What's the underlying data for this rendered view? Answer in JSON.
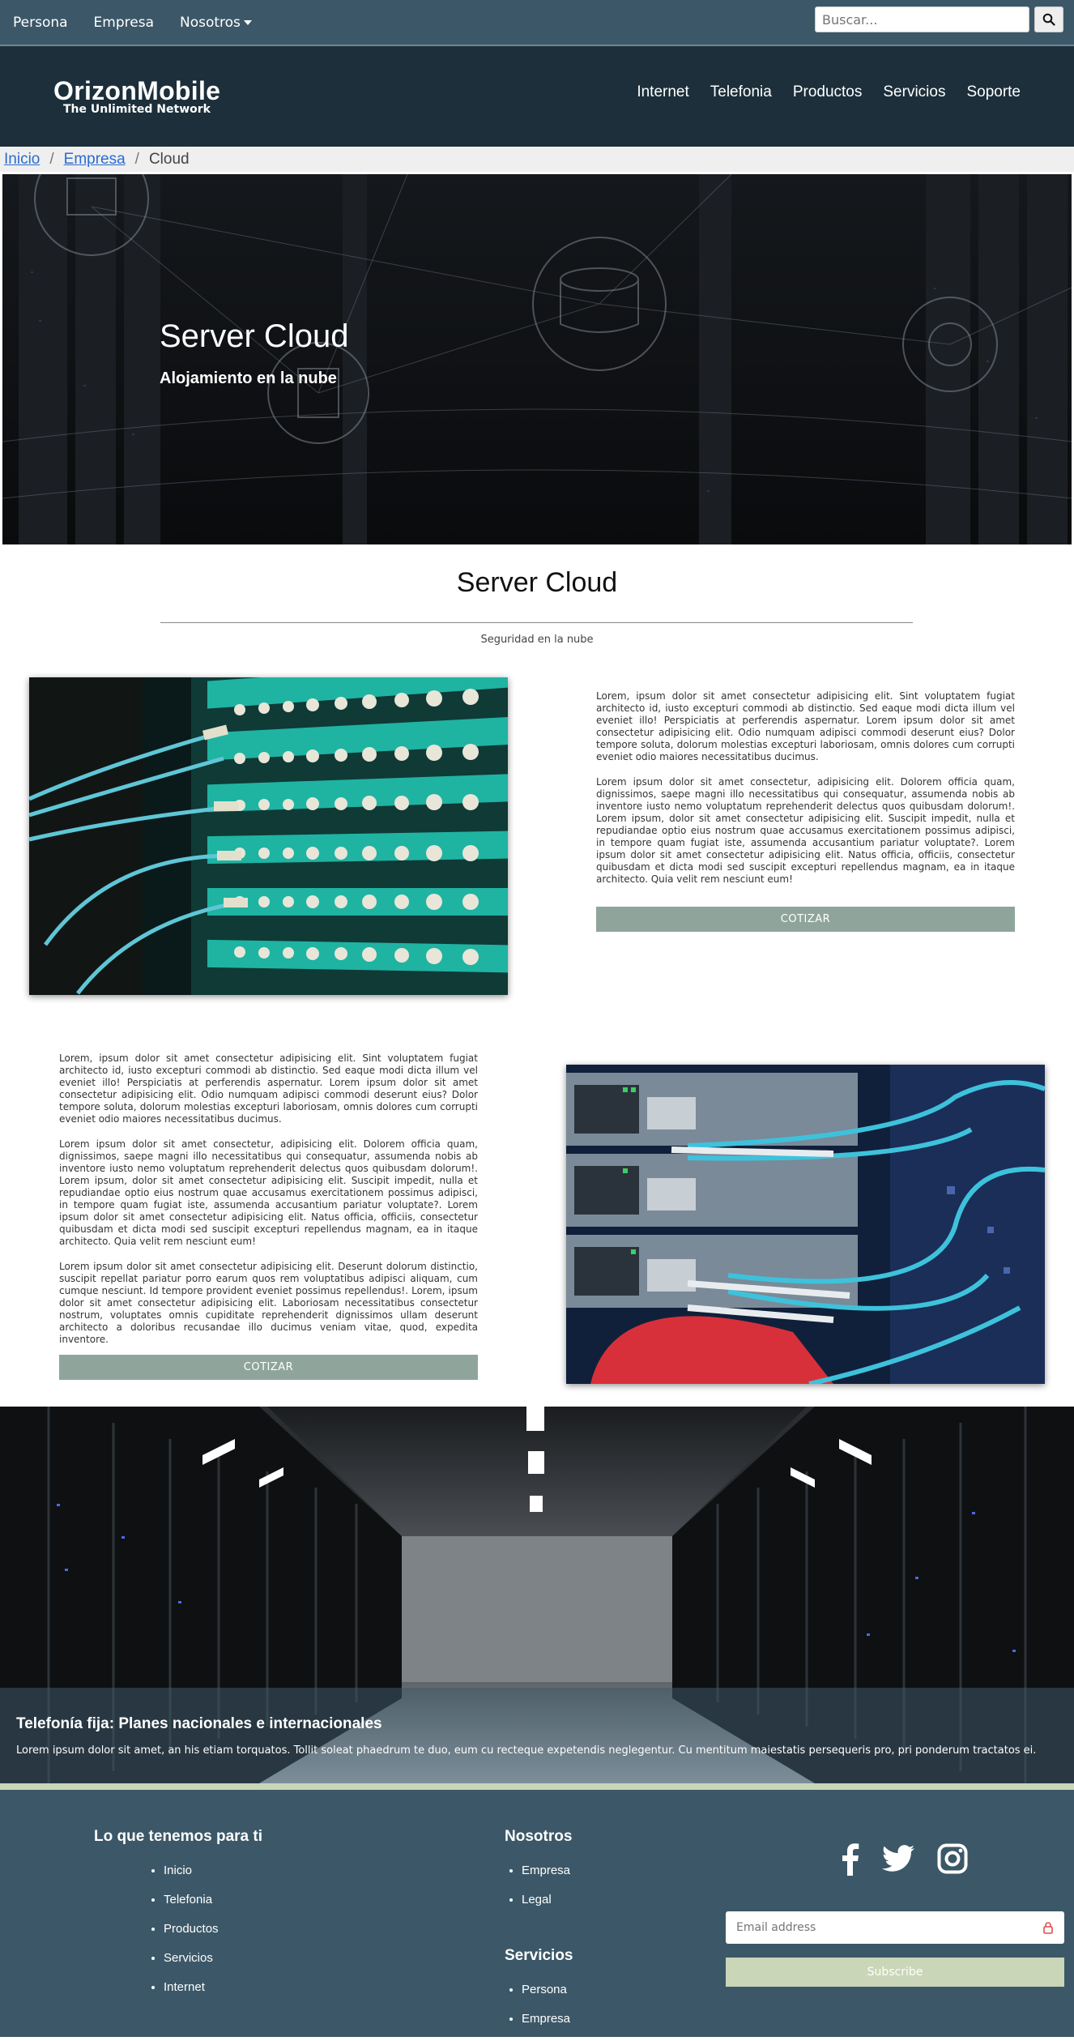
{
  "topbar": {
    "links": [
      "Persona",
      "Empresa",
      "Nosotros"
    ],
    "search_placeholder": "Buscar..."
  },
  "header": {
    "logo_name": "OrizonMobile",
    "logo_tagline": "The Unlimited Network",
    "nav": [
      "Internet",
      "Telefonia",
      "Productos",
      "Servicios",
      "Soporte"
    ]
  },
  "breadcrumb": {
    "items": [
      "Inicio",
      "Empresa",
      "Cloud"
    ],
    "separator": "/"
  },
  "hero": {
    "title": "Server Cloud",
    "subtitle": "Alojamiento en la nube"
  },
  "section": {
    "title": "Server Cloud",
    "subtitle": "Seguridad en la nube"
  },
  "block1": {
    "paragraphs": [
      "Lorem, ipsum dolor sit amet consectetur adipisicing elit. Sint voluptatem fugiat architecto id, iusto excepturi commodi ab distinctio. Sed eaque modi dicta illum vel eveniet illo! Perspiciatis at perferendis aspernatur. Lorem ipsum dolor sit amet consectetur adipisicing elit. Odio numquam adipisci commodi deserunt eius? Dolor tempore soluta, dolorum molestias excepturi laboriosam, omnis dolores cum corrupti eveniet odio maiores necessitatibus ducimus.",
      "Lorem ipsum dolor sit amet consectetur, adipisicing elit. Dolorem officia quam, dignissimos, saepe magni illo necessitatibus qui consequatur, assumenda nobis ab inventore iusto nemo voluptatum reprehenderit delectus quos quibusdam dolorum!. Lorem ipsum, dolor sit amet consectetur adipisicing elit. Suscipit impedit, nulla et repudiandae optio eius nostrum quae accusamus exercitationem possimus adipisci, in tempore quam fugiat iste, assumenda accusantium pariatur voluptate?. Lorem ipsum dolor sit amet consectetur adipisicing elit. Natus officia, officiis, consectetur quibusdam et dicta modi sed suscipit excepturi repellendus magnam, ea in itaque architecto. Quia velit rem nesciunt eum!"
    ],
    "button": "COTIZAR"
  },
  "block2": {
    "paragraphs": [
      "Lorem, ipsum dolor sit amet consectetur adipisicing elit. Sint voluptatem fugiat architecto id, iusto excepturi commodi ab distinctio. Sed eaque modi dicta illum vel eveniet illo! Perspiciatis at perferendis aspernatur. Lorem ipsum dolor sit amet consectetur adipisicing elit. Odio numquam adipisci commodi deserunt eius? Dolor tempore soluta, dolorum molestias excepturi laboriosam, omnis dolores cum corrupti eveniet odio maiores necessitatibus ducimus.",
      "Lorem ipsum dolor sit amet consectetur, adipisicing elit. Dolorem officia quam, dignissimos, saepe magni illo necessitatibus qui consequatur, assumenda nobis ab inventore iusto nemo voluptatum reprehenderit delectus quos quibusdam dolorum!. Lorem ipsum, dolor sit amet consectetur adipisicing elit. Suscipit impedit, nulla et repudiandae optio eius nostrum quae accusamus exercitationem possimus adipisci, in tempore quam fugiat iste, assumenda accusantium pariatur voluptate?. Lorem ipsum dolor sit amet consectetur adipisicing elit. Natus officia, officiis, consectetur quibusdam et dicta modi sed suscipit excepturi repellendus magnam, ea in itaque architecto. Quia velit rem nesciunt eum!",
      "Lorem ipsum dolor sit amet consectetur adipisicing elit. Deserunt dolorum distinctio, suscipit repellat pariatur porro earum quos rem voluptatibus adipisci aliquam, cum cumque nesciunt. Id tempore provident eveniet possimus repellendus!. Lorem, ipsum dolor sit amet consectetur adipisicing elit. Laboriosam necessitatibus consectetur nostrum, voluptates omnis cupiditate reprehenderit dignissimos ullam deserunt architecto a doloribus recusandae illo ducimus veniam vitae, quod, expedita inventore."
    ],
    "button": "COTIZAR"
  },
  "banner": {
    "title": "Telefonía fija: Planes nacionales e internacionales",
    "text": "Lorem ipsum dolor sit amet, an his etiam torquatos. Tollit soleat phaedrum te duo, eum cu recteque expetendis neglegentur. Cu mentitum maiestatis persequeris pro, pri ponderum tractatos ei."
  },
  "footer": {
    "col1": {
      "title": "Lo que tenemos para ti",
      "items": [
        "Inicio",
        "Telefonia",
        "Productos",
        "Servicios",
        "Internet"
      ]
    },
    "col2": {
      "title": "Nosotros",
      "items": [
        "Empresa",
        "Legal"
      ]
    },
    "col3": {
      "title": "Servicios",
      "items": [
        "Persona",
        "Empresa"
      ]
    },
    "social_icons": [
      "facebook-icon",
      "twitter-icon",
      "instagram-icon"
    ],
    "email_placeholder": "Email address",
    "subscribe_label": "Subscribe"
  },
  "colors": {
    "topbar": "#3c5868",
    "header": "#1c2f3a",
    "button": "#8fa59b",
    "accent_light": "#c9d6b8",
    "link": "#2a6bd1"
  }
}
